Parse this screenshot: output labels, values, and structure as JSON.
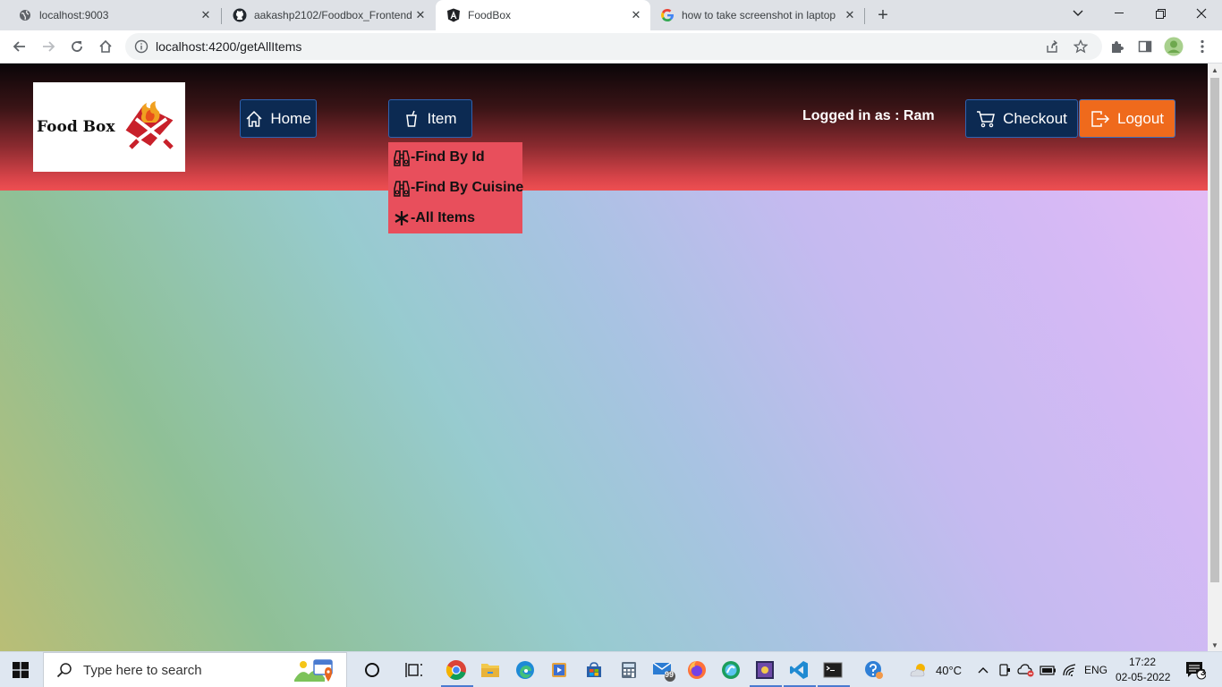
{
  "browser": {
    "tabs": [
      {
        "title": "localhost:9003",
        "favicon": "globe-icon"
      },
      {
        "title": "aakashp2102/Foodbox_Frontend",
        "favicon": "github-icon"
      },
      {
        "title": "FoodBox",
        "favicon": "angular-icon",
        "active": true
      },
      {
        "title": "how to take screenshot in laptop",
        "favicon": "google-icon"
      }
    ],
    "url": "localhost:4200/getAllItems"
  },
  "navbar": {
    "logo_text": "Food Box",
    "home_label": "Home",
    "item_label": "Item",
    "logged_in": "Logged in as : Ram",
    "checkout_label": "Checkout",
    "logout_label": "Logout"
  },
  "dropdown": {
    "items": [
      {
        "label": "-Find By Id",
        "icon": "binoculars-icon"
      },
      {
        "label": "-Find By Cuisine",
        "icon": "binoculars-icon"
      },
      {
        "label": "-All Items",
        "icon": "asterisk-icon"
      }
    ]
  },
  "taskbar": {
    "search_placeholder": "Type here to search",
    "temperature": "40°C",
    "language": "ENG",
    "time": "17:22",
    "date": "02-05-2022",
    "notification_count": "3",
    "mail_badge": "99"
  },
  "colors": {
    "nav_button": "#0c2a52",
    "logout_button": "#ef6a1c",
    "dropdown_bg": "#e84f5c"
  }
}
